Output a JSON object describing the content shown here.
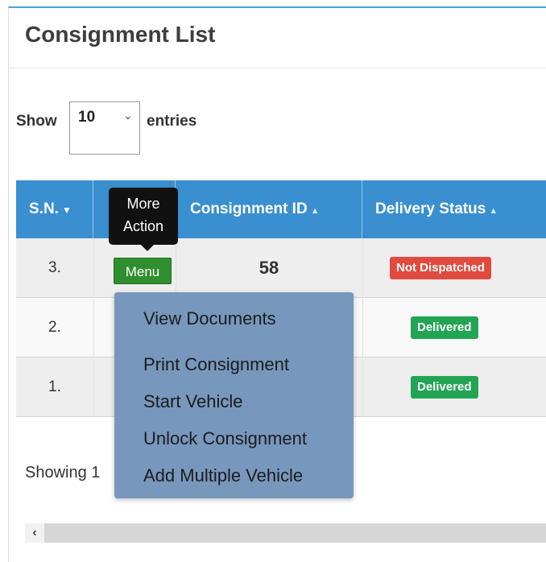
{
  "page": {
    "title": "Consignment List"
  },
  "length_control": {
    "show_label": "Show",
    "selected": "10",
    "entries_label": "entries"
  },
  "table": {
    "headers": [
      "S.N.",
      "",
      "Consignment ID",
      "Delivery Status"
    ],
    "rows": [
      {
        "sn": "3.",
        "consignment_id": "58",
        "status": "Not Dispatched"
      },
      {
        "sn": "2.",
        "consignment_id": "",
        "status": "Delivered"
      },
      {
        "sn": "1.",
        "consignment_id": "",
        "status": "Delivered"
      }
    ]
  },
  "action": {
    "tooltip_line1": "More",
    "tooltip_line2": "Action",
    "menu_label": "Menu",
    "dropdown_items": [
      "View Documents",
      "Print Consignment",
      "Start Vehicle",
      "Unlock Consignment",
      "Add Multiple Vehicle"
    ]
  },
  "footer": {
    "showing_text": "Showing 1"
  },
  "colors": {
    "header_bg": "#3a8fd0",
    "menu_button": "#2f8f2f",
    "badge_not_dispatched": "#e14a3f",
    "badge_delivered": "#23a454",
    "dropdown_bg": "#7797bd"
  },
  "icons": {
    "sort_active": "caret-down-icon",
    "sort": "sort-icon",
    "scroll_left": "chevron-left-icon",
    "select": "chevron-down-icon"
  }
}
